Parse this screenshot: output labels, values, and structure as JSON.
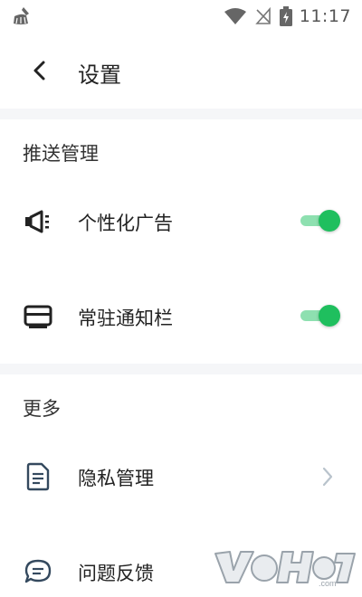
{
  "status_bar": {
    "time": "11:17",
    "icons": [
      "cleaner-app-icon",
      "wifi-icon",
      "no-signal-icon",
      "battery-charging-icon"
    ]
  },
  "header": {
    "title": "设置",
    "back_icon": "chevron-left-icon"
  },
  "sections": {
    "push": {
      "title": "推送管理",
      "items": [
        {
          "label": "个性化广告",
          "icon": "megaphone-icon",
          "enabled": true
        },
        {
          "label": "常驻通知栏",
          "icon": "notification-bar-icon",
          "enabled": true
        }
      ]
    },
    "more": {
      "title": "更多",
      "items": [
        {
          "label": "隐私管理",
          "icon": "document-icon",
          "trailing": "chevron-right-icon"
        },
        {
          "label": "问题反馈",
          "icon": "chat-bubble-icon"
        }
      ]
    }
  },
  "colors": {
    "toggle_on": "#1fbf5e",
    "toggle_track": "#8ee0b0",
    "divider": "#f5f6f8",
    "text": "#222222"
  },
  "watermark": {
    "text": "vohoo",
    "suffix": ".com",
    "icon": "watermark-logo"
  }
}
